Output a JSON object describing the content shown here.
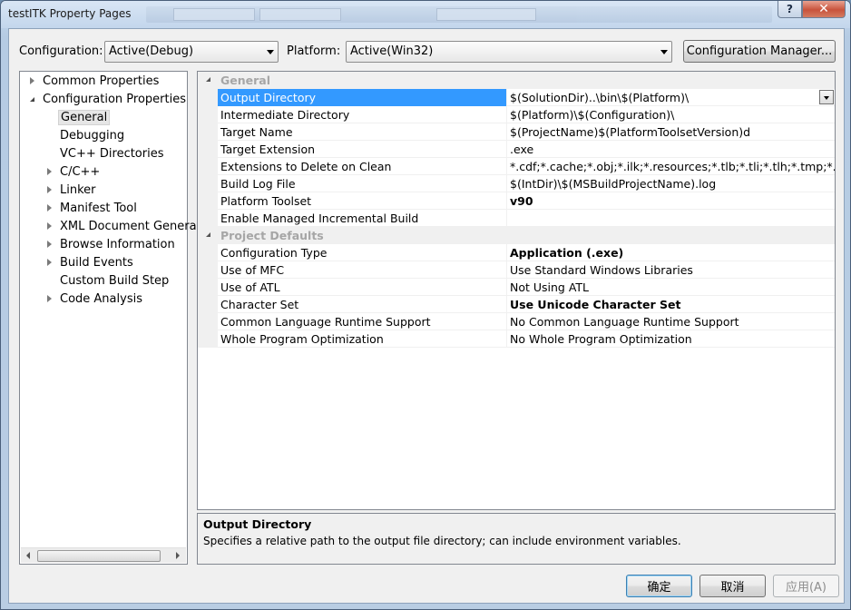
{
  "window": {
    "title": "testITK Property Pages",
    "help_glyph": "?",
    "close_glyph": "✕"
  },
  "config": {
    "configuration_label": "Configuration:",
    "configuration_value": "Active(Debug)",
    "platform_label": "Platform:",
    "platform_value": "Active(Win32)",
    "manager_button": "Configuration Manager..."
  },
  "tree": [
    {
      "label": "Common Properties",
      "level": 0,
      "expander": "closed"
    },
    {
      "label": "Configuration Properties",
      "level": 0,
      "expander": "open"
    },
    {
      "label": "General",
      "level": 1,
      "expander": "none",
      "selected": true
    },
    {
      "label": "Debugging",
      "level": 1,
      "expander": "none"
    },
    {
      "label": "VC++ Directories",
      "level": 1,
      "expander": "none"
    },
    {
      "label": "C/C++",
      "level": 1,
      "expander": "closed"
    },
    {
      "label": "Linker",
      "level": 1,
      "expander": "closed"
    },
    {
      "label": "Manifest Tool",
      "level": 1,
      "expander": "closed"
    },
    {
      "label": "XML Document Generat",
      "level": 1,
      "expander": "closed"
    },
    {
      "label": "Browse Information",
      "level": 1,
      "expander": "closed"
    },
    {
      "label": "Build Events",
      "level": 1,
      "expander": "closed"
    },
    {
      "label": "Custom Build Step",
      "level": 1,
      "expander": "none"
    },
    {
      "label": "Code Analysis",
      "level": 1,
      "expander": "closed"
    }
  ],
  "grid": {
    "categories": [
      {
        "name": "General",
        "rows": [
          {
            "key": "Output Directory",
            "value": "$(SolutionDir)..\\bin\\$(Platform)\\",
            "selected": true
          },
          {
            "key": "Intermediate Directory",
            "value": "$(Platform)\\$(Configuration)\\"
          },
          {
            "key": "Target Name",
            "value": "$(ProjectName)$(PlatformToolsetVersion)d"
          },
          {
            "key": "Target Extension",
            "value": ".exe"
          },
          {
            "key": "Extensions to Delete on Clean",
            "value": "*.cdf;*.cache;*.obj;*.ilk;*.resources;*.tlb;*.tli;*.tlh;*.tmp;*.rsp;*.pgc"
          },
          {
            "key": "Build Log File",
            "value": "$(IntDir)\\$(MSBuildProjectName).log"
          },
          {
            "key": "Platform Toolset",
            "value": "v90",
            "bold": true
          },
          {
            "key": "Enable Managed Incremental Build",
            "value": ""
          }
        ]
      },
      {
        "name": "Project Defaults",
        "rows": [
          {
            "key": "Configuration Type",
            "value": "Application (.exe)",
            "bold": true
          },
          {
            "key": "Use of MFC",
            "value": "Use Standard Windows Libraries"
          },
          {
            "key": "Use of ATL",
            "value": "Not Using ATL"
          },
          {
            "key": "Character Set",
            "value": "Use Unicode Character Set",
            "bold": true
          },
          {
            "key": "Common Language Runtime Support",
            "value": "No Common Language Runtime Support"
          },
          {
            "key": "Whole Program Optimization",
            "value": "No Whole Program Optimization"
          }
        ]
      }
    ]
  },
  "description": {
    "title": "Output Directory",
    "text": "Specifies a relative path to the output file directory; can include environment variables."
  },
  "buttons": {
    "ok": "确定",
    "cancel": "取消",
    "apply": "应用(A)"
  },
  "colors": {
    "selection": "#3399ff",
    "category_text": "#a6a6a6"
  }
}
